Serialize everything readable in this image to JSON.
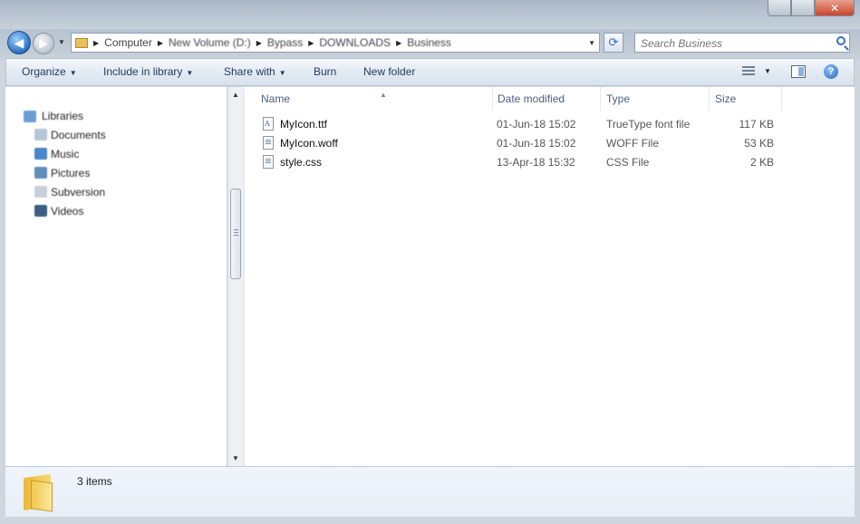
{
  "window": {
    "close_glyph": "✕"
  },
  "address": {
    "crumbs": [
      "Computer",
      "New Volume (D:)",
      "Bypass",
      "DOWNLOADS",
      "Business"
    ],
    "refresh_glyph": "⟳",
    "search_placeholder": "Search Business"
  },
  "toolbar": {
    "organize": "Organize",
    "include_in_library": "Include in library",
    "share_with": "Share with",
    "burn": "Burn",
    "new_folder": "New folder",
    "help_glyph": "?"
  },
  "navpane": {
    "items": [
      {
        "label": "Libraries",
        "icon": "libraries-icon",
        "color": "#6a9fd4"
      },
      {
        "label": "Documents",
        "icon": "documents-icon",
        "color": "#b7c6d8"
      },
      {
        "label": "Music",
        "icon": "music-icon",
        "color": "#4a86c8"
      },
      {
        "label": "Pictures",
        "icon": "pictures-icon",
        "color": "#5f8fb8"
      },
      {
        "label": "Subversion",
        "icon": "subversion-icon",
        "color": "#c7d0da"
      },
      {
        "label": "Videos",
        "icon": "videos-icon",
        "color": "#3d5f86"
      }
    ]
  },
  "columns": {
    "name": "Name",
    "date_modified": "Date modified",
    "type": "Type",
    "size": "Size"
  },
  "files": [
    {
      "name": "MyIcon.ttf",
      "date": "01-Jun-18 15:02",
      "type": "TrueType font file",
      "size": "117 KB",
      "icon": "font-file-icon"
    },
    {
      "name": "MyIcon.woff",
      "date": "01-Jun-18 15:02",
      "type": "WOFF File",
      "size": "53 KB",
      "icon": "woff-file-icon"
    },
    {
      "name": "style.css",
      "date": "13-Apr-18 15:32",
      "type": "CSS File",
      "size": "2 KB",
      "icon": "css-file-icon"
    }
  ],
  "details": {
    "item_count": "3 items"
  }
}
